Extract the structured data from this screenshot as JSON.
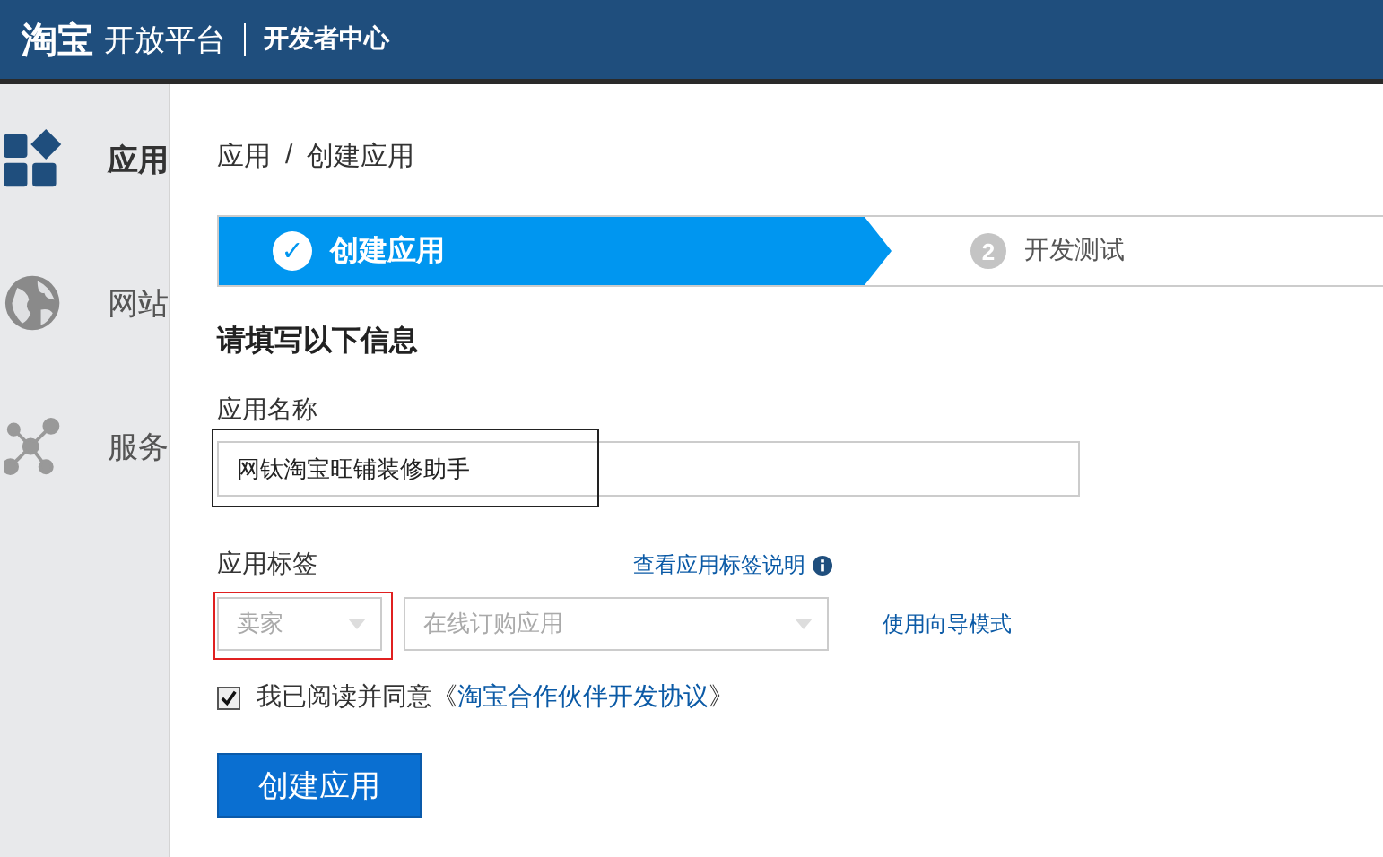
{
  "header": {
    "logo": "淘宝",
    "brand": "开放平台",
    "section": "开发者中心"
  },
  "sidebar": {
    "items": [
      {
        "kind": "apps",
        "label": "应用",
        "selected": true
      },
      {
        "kind": "globe",
        "label": "网站",
        "selected": false
      },
      {
        "kind": "nodes",
        "label": "服务",
        "selected": false
      }
    ]
  },
  "breadcrumb": [
    "应用",
    "/",
    "创建应用"
  ],
  "steps": [
    {
      "number": "✓",
      "label": "创建应用",
      "selected": true
    },
    {
      "number": "2",
      "label": "开发测试",
      "selected": false
    }
  ],
  "form": {
    "heading": "请填写以下信息",
    "name_label": "应用名称",
    "name_value": "网钛淘宝旺铺装修助手",
    "tag_label": "应用标签",
    "tag_help_link": "查看应用标签说明",
    "tag_selects": [
      {
        "value": "卖家",
        "disabled": true
      },
      {
        "value": "在线订购应用",
        "disabled": true
      }
    ],
    "wizard_link": "使用向导模式",
    "agree": {
      "checked": true,
      "text": "我已阅读并同意《",
      "link": "淘宝合作伙伴开发协议",
      "end": "》"
    },
    "submit": "创建应用"
  },
  "name_annotation": {
    "color": "#222222"
  },
  "tag_annotation": {
    "color": "#e02020"
  }
}
